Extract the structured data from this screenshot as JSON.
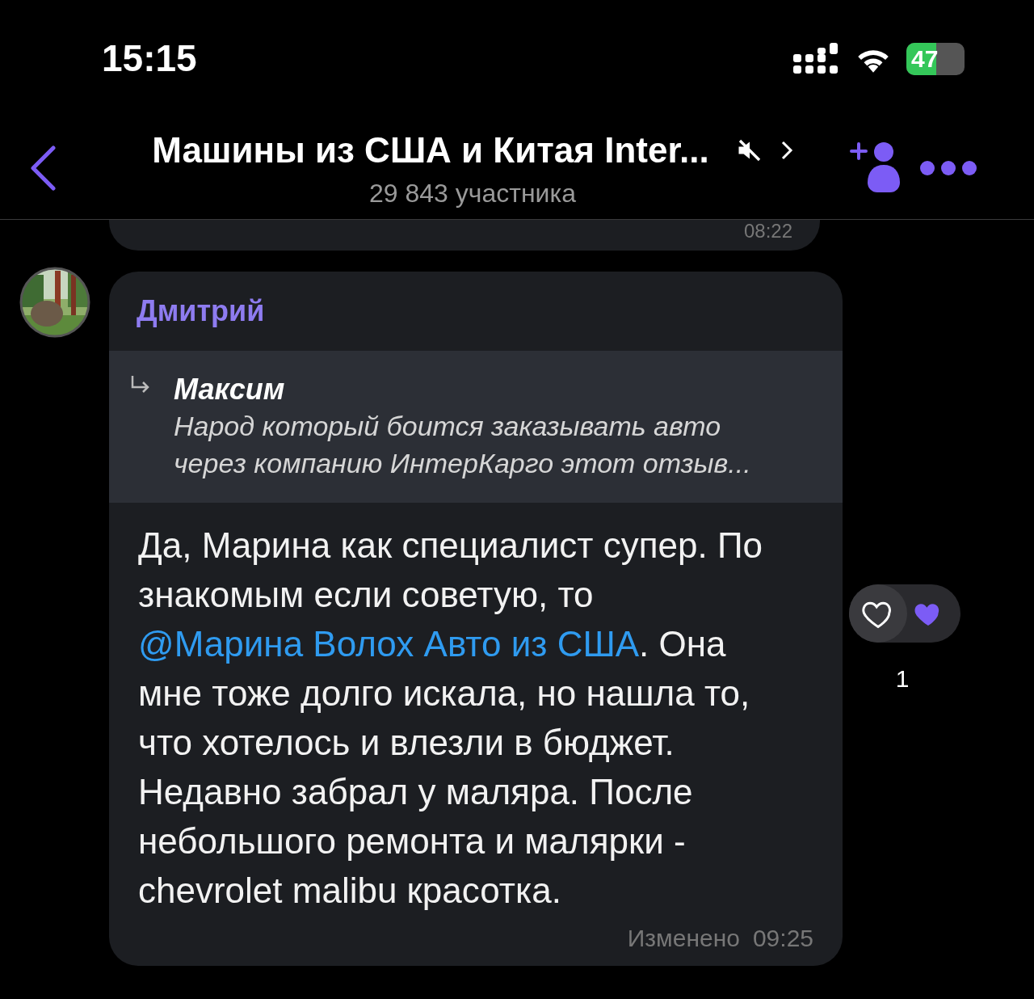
{
  "status_bar": {
    "time": "15:15",
    "battery": "47"
  },
  "header": {
    "title": "Машины из США и Китая Inter...",
    "muted": true,
    "subtitle": "29 843 участника"
  },
  "previous_message": {
    "time": "08:22"
  },
  "message": {
    "sender": "Дмитрий",
    "reply": {
      "author": "Максим",
      "text": "Народ который боится заказывать авто через компанию ИнтерКарго этот отзыв..."
    },
    "text_before": "Да, Марина как специалист супер. По знакомым если советую, то ",
    "mention": "@Марина Волох Авто из США",
    "text_after": ". Она мне тоже долго искала, но нашла то, что хотелось и влезли в бюджет. Недавно забрал у маляра. После небольшого ремонта и малярки - chevrolet malibu красотка.",
    "edited": "Изменено",
    "time": "09:25",
    "reactions": [
      {
        "kind": "outline",
        "selected": false
      },
      {
        "kind": "filled",
        "selected": true
      }
    ],
    "reaction_count": "1"
  }
}
